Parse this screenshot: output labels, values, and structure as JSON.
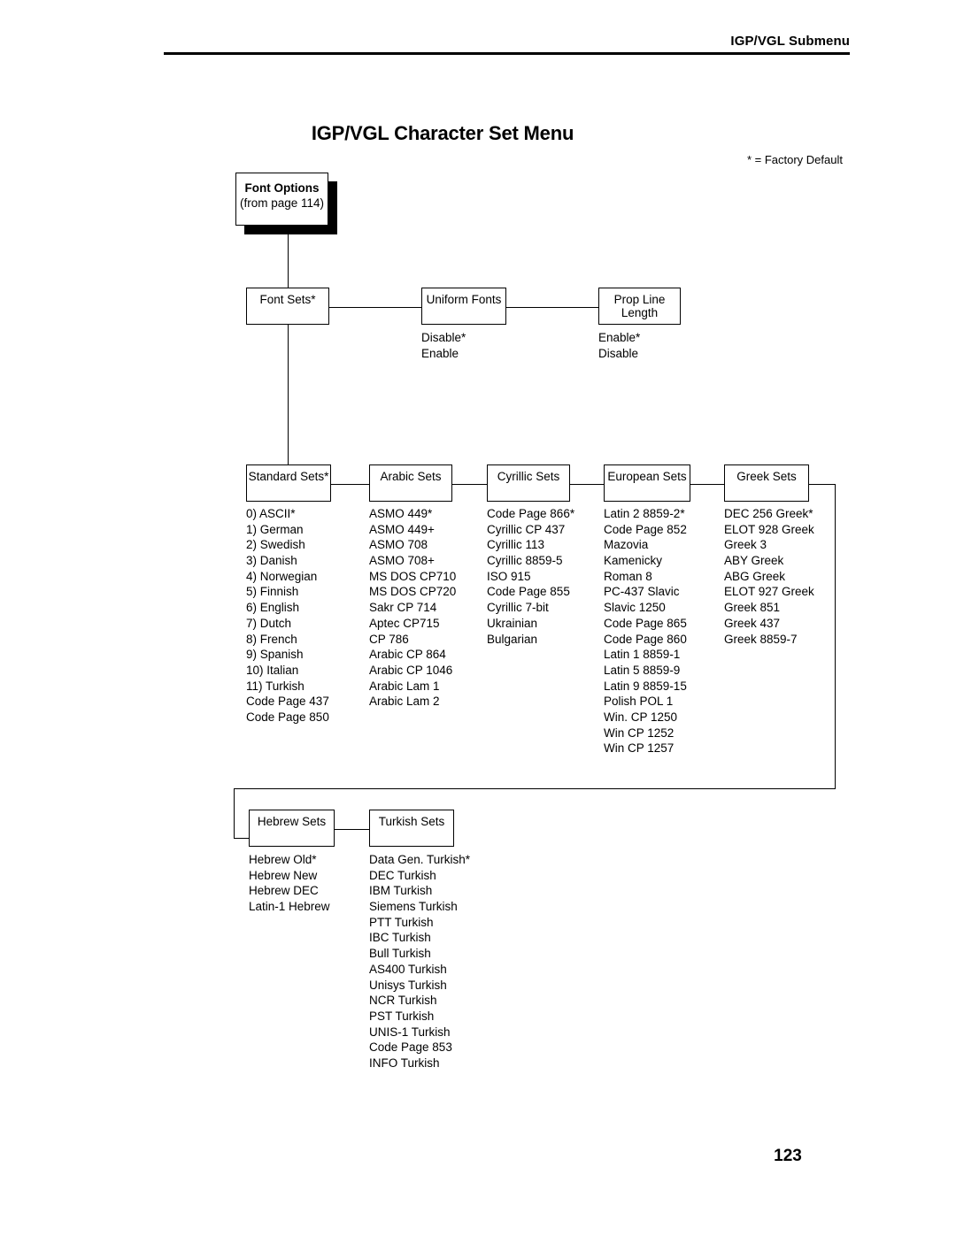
{
  "header": {
    "running_head": "IGP/VGL Submenu",
    "page_number": "123"
  },
  "figure": {
    "title": "IGP/VGL Character Set Menu",
    "legend": "* = Factory Default"
  },
  "root": {
    "title": "Font Options",
    "subtitle": "(from page 114)"
  },
  "nodes": {
    "font_sets": "Font Sets*",
    "uniform_fonts": "Uniform Fonts",
    "prop_line_length_l1": "Prop Line",
    "prop_line_length_l2": "Length",
    "standard_sets": "Standard Sets*",
    "arabic_sets": "Arabic Sets",
    "cyrillic_sets": "Cyrillic Sets",
    "european_sets": "European Sets",
    "greek_sets": "Greek Sets",
    "hebrew_sets": "Hebrew Sets",
    "turkish_sets": "Turkish Sets"
  },
  "options": {
    "uniform_fonts": [
      "Disable*",
      "Enable"
    ],
    "prop_line_length": [
      "Enable*",
      "Disable"
    ],
    "standard_sets": [
      "0) ASCII*",
      "1) German",
      "2) Swedish",
      "3) Danish",
      "4) Norwegian",
      "5) Finnish",
      "6) English",
      "7) Dutch",
      "8) French",
      "9) Spanish",
      "10) Italian",
      "11) Turkish",
      "Code Page 437",
      "Code Page 850"
    ],
    "arabic_sets": [
      "ASMO 449*",
      "ASMO 449+",
      "ASMO 708",
      "ASMO 708+",
      "MS DOS CP710",
      "MS DOS CP720",
      "Sakr CP 714",
      "Aptec CP715",
      "CP 786",
      "Arabic CP 864",
      "Arabic CP 1046",
      "Arabic Lam 1",
      "Arabic Lam 2"
    ],
    "cyrillic_sets": [
      "Code Page 866*",
      "Cyrillic CP 437",
      "Cyrillic 113",
      "Cyrillic 8859-5",
      "ISO 915",
      "Code Page 855",
      "Cyrillic 7-bit",
      "Ukrainian",
      "Bulgarian"
    ],
    "european_sets": [
      "Latin 2 8859-2*",
      "Code Page 852",
      "Mazovia",
      "Kamenicky",
      "Roman 8",
      "PC-437 Slavic",
      "Slavic 1250",
      "Code Page 865",
      "Code Page 860",
      "Latin 1 8859-1",
      "Latin 5 8859-9",
      "Latin 9 8859-15",
      "Polish POL 1",
      "Win. CP 1250",
      "Win CP 1252",
      "Win CP 1257"
    ],
    "greek_sets": [
      "DEC 256 Greek*",
      "ELOT 928 Greek",
      "Greek 3",
      "ABY Greek",
      "ABG Greek",
      "ELOT 927 Greek",
      "Greek 851",
      "Greek 437",
      "Greek 8859-7"
    ],
    "hebrew_sets": [
      "Hebrew Old*",
      "Hebrew New",
      "Hebrew DEC",
      "Latin-1 Hebrew"
    ],
    "turkish_sets": [
      "Data Gen. Turkish*",
      "DEC Turkish",
      "IBM Turkish",
      "Siemens Turkish",
      "PTT Turkish",
      "IBC Turkish",
      "Bull Turkish",
      "AS400 Turkish",
      "Unisys Turkish",
      "NCR Turkish",
      "PST Turkish",
      "UNIS-1 Turkish",
      "Code Page 853",
      "INFO Turkish"
    ]
  }
}
